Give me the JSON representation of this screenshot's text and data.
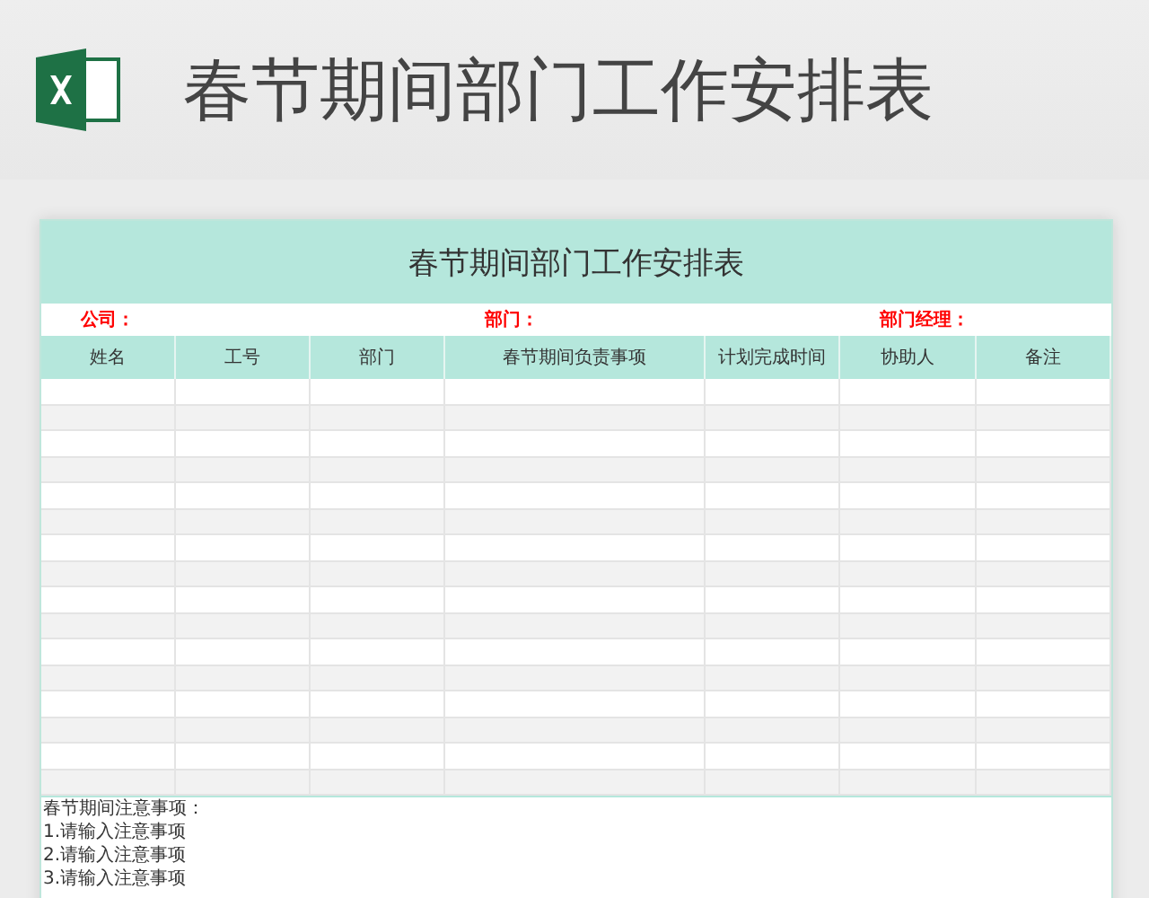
{
  "header": {
    "title": "春节期间部门工作安排表"
  },
  "sheet": {
    "title": "春节期间部门工作安排表",
    "info": [
      "公司：",
      "部门：",
      "部门经理："
    ],
    "columns": [
      "姓名",
      "工号",
      "部门",
      "春节期间负责事项",
      "计划完成时间",
      "协助人",
      "备注"
    ],
    "notes": [
      "春节期间注意事项：",
      "1.请输入注意事项",
      "2.请输入注意事项",
      "3.请输入注意事项"
    ]
  }
}
